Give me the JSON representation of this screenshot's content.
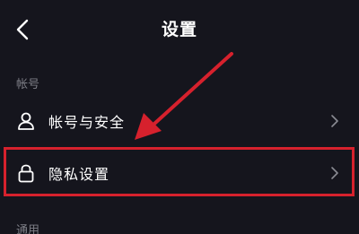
{
  "header": {
    "title": "设置",
    "back_icon": "chevron-left-icon"
  },
  "sections": {
    "account": {
      "label": "帐号"
    },
    "general": {
      "label": "通用"
    }
  },
  "rows": [
    {
      "label": "帐号与安全",
      "icon": "user-icon"
    },
    {
      "label": "隐私设置",
      "icon": "lock-icon"
    }
  ],
  "colors": {
    "background": "#15151d",
    "text": "#ffffff",
    "muted": "#7d7e86",
    "annotation": "#d6212d"
  }
}
